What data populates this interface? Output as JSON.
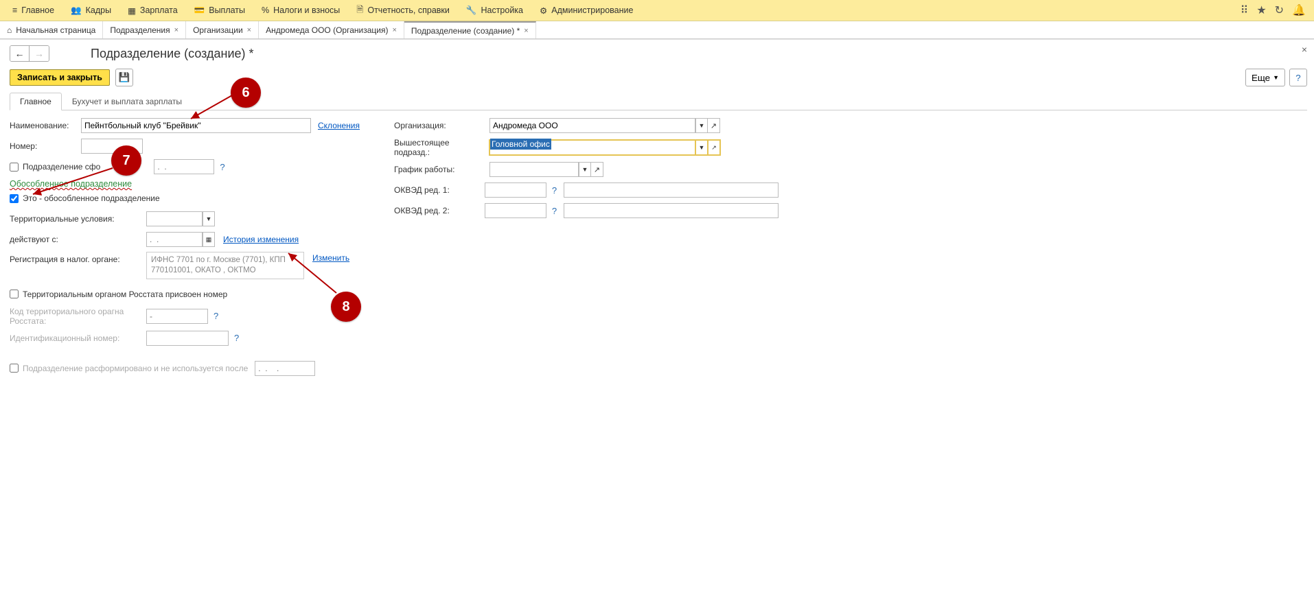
{
  "top_menu": {
    "main": "Главное",
    "kadry": "Кадры",
    "zarplata": "Зарплата",
    "vyplaty": "Выплаты",
    "nalogi": "Налоги и взносы",
    "otchet": "Отчетность, справки",
    "nastroika": "Настройка",
    "admin": "Администрирование"
  },
  "tabs": {
    "home": "Начальная страница",
    "podrazdel": "Подразделения",
    "org": "Организации",
    "andromeda": "Андромеда ООО (Организация)",
    "create": "Подразделение (создание) *"
  },
  "page": {
    "title": "Подразделение (создание) *"
  },
  "cmd": {
    "save_close": "Записать и закрыть",
    "more": "Еще",
    "help": "?"
  },
  "inner_tabs": {
    "main": "Главное",
    "accounting": "Бухучет и выплата зарплаты"
  },
  "left": {
    "name_label": "Наименование:",
    "name_value": "Пейнтбольный клуб \"Брейвик\"",
    "declensions": "Склонения",
    "number_label": "Номер:",
    "formed_label": "Подразделение сфо",
    "sep_title": "Обособленное подразделение",
    "is_sep_label": "Это - обособленное подразделение",
    "terr_label": "Территориальные условия:",
    "valid_from_label": "действуют с:",
    "history": "История изменения",
    "reg_label": "Регистрация в налог. органе:",
    "reg_text": "ИФНС 7701 по г. Москве (7701), КПП 770101001, ОКАТО , ОКТМО",
    "change": "Изменить",
    "rosstat_cbx": "Территориальным органом Росстата присвоен номер",
    "rosstat_code_label": "Код территориального орагна Росстата:",
    "rosstat_code_ph": "-",
    "id_label": "Идентификационный номер:",
    "disband_label": "Подразделение расформировано и не используется после",
    "date_ph": ".  .",
    "date_ph2": ".  .    ."
  },
  "right": {
    "org_label": "Организация:",
    "org_value": "Андромеда ООО",
    "parent_label": "Вышестоящее подразд.:",
    "parent_value": "Головной офис",
    "schedule_label": "График работы:",
    "okved1_label": "ОКВЭД ред. 1:",
    "okved2_label": "ОКВЭД ред. 2:"
  },
  "badges": {
    "b6": "6",
    "b7": "7",
    "b8": "8"
  }
}
